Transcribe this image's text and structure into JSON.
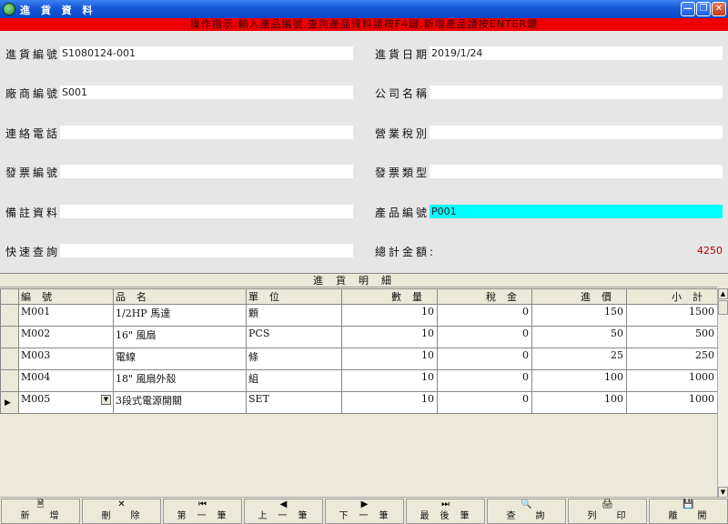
{
  "window": {
    "title": "進 貨 資 料"
  },
  "banner": {
    "text": "操作指示:輸入產品編號,查詢產品資料請按F4鍵,新增產品請按ENTER鍵"
  },
  "form": {
    "purchase_no_label": "進貨編號:",
    "purchase_no_value": "S1080124-001",
    "purchase_date_label": "進貨日期:",
    "purchase_date_value": "2019/1/24",
    "vendor_no_label": "廠商編號:",
    "vendor_no_value": "S001",
    "company_name_label": "公司名稱:",
    "company_name_value": "",
    "phone_label": "連絡電話:",
    "phone_value": "",
    "tax_type_label": "營業稅別:",
    "tax_type_value": "",
    "invoice_no_label": "發票編號:",
    "invoice_no_value": "",
    "invoice_type_label": "發票類型:",
    "invoice_type_value": "",
    "remarks_label": "備註資料:",
    "remarks_value": "",
    "product_no_label": "產品編號:",
    "product_no_value": "P001",
    "quick_search_label": "快速查詢:",
    "quick_search_value": "",
    "total_label": "總計金額:",
    "total_value": "4250"
  },
  "grid": {
    "caption": "進貨明細",
    "columns": [
      "編號",
      "品名",
      "單位",
      "數量",
      "稅金",
      "進價",
      "小計"
    ],
    "rows": [
      {
        "code": "M001",
        "name": "1/2HP 馬達",
        "unit": "顆",
        "qty": "10",
        "tax": "0",
        "price": "150",
        "subtotal": "1500"
      },
      {
        "code": "M002",
        "name": "16\" 風扇",
        "unit": "PCS",
        "qty": "10",
        "tax": "0",
        "price": "50",
        "subtotal": "500"
      },
      {
        "code": "M003",
        "name": "電線",
        "unit": "條",
        "qty": "10",
        "tax": "0",
        "price": "25",
        "subtotal": "250"
      },
      {
        "code": "M004",
        "name": "18\" 風扇外殼",
        "unit": "組",
        "qty": "10",
        "tax": "0",
        "price": "100",
        "subtotal": "1000"
      },
      {
        "code": "M005",
        "name": "3段式電源開關",
        "unit": "SET",
        "qty": "10",
        "tax": "0",
        "price": "100",
        "subtotal": "1000"
      }
    ]
  },
  "toolbar": {
    "buttons": [
      {
        "label": "新增",
        "icon": "new-document-icon"
      },
      {
        "label": "刪除",
        "icon": "delete-x-icon"
      },
      {
        "label": "第一筆",
        "icon": "first-record-icon"
      },
      {
        "label": "上一筆",
        "icon": "previous-record-icon"
      },
      {
        "label": "下一筆",
        "icon": "next-record-icon"
      },
      {
        "label": "最後筆",
        "icon": "last-record-icon"
      },
      {
        "label": "查詢",
        "icon": "search-icon"
      },
      {
        "label": "列印",
        "icon": "printer-icon"
      },
      {
        "label": "離開",
        "icon": "save-exit-icon"
      }
    ]
  }
}
